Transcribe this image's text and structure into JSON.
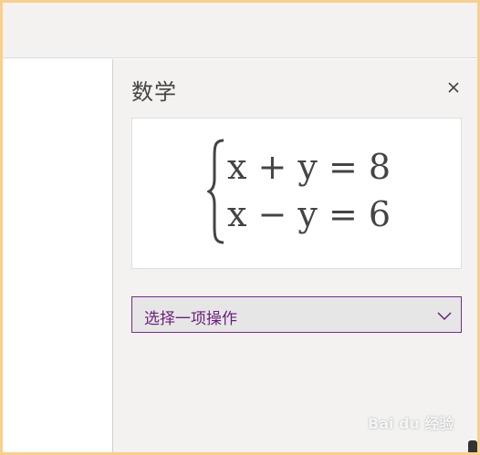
{
  "panel": {
    "title": "数学",
    "close_symbol": "×",
    "close_icon": "close-icon"
  },
  "equation": {
    "line1": "x + y = 8",
    "line2": "x − y = 6"
  },
  "action_dropdown": {
    "selected_label": "选择一项操作",
    "icon": "chevron-down-icon"
  },
  "watermark": {
    "text": "Bai du 经验"
  },
  "colors": {
    "accent": "#6b1f7c",
    "border_frame": "#f7cf8e",
    "panel_bg": "#f3f2f1"
  }
}
